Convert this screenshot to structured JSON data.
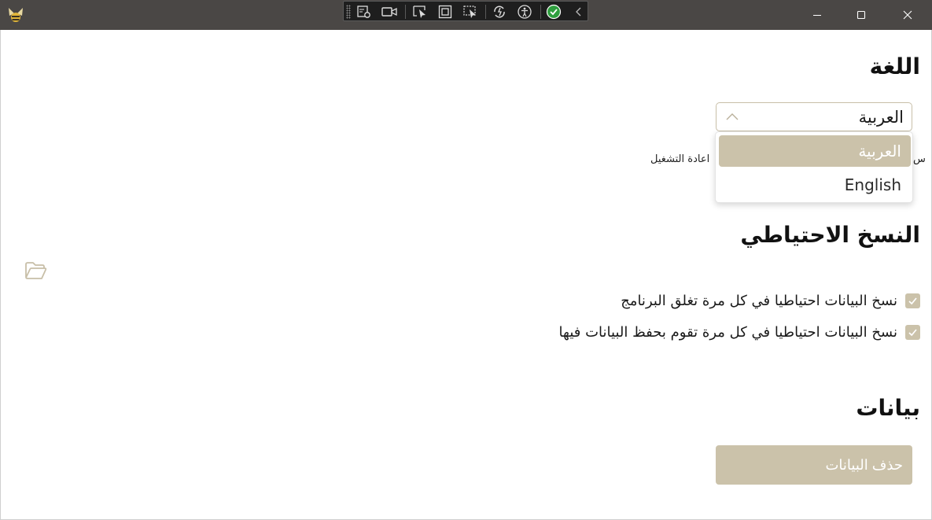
{
  "window": {
    "app_icon": "bee-logo-icon",
    "controls": {
      "minimize": "minimize-icon",
      "maximize": "maximize-icon",
      "close": "close-icon"
    }
  },
  "devtools_toolbar": {
    "items": [
      "live-visual-tree-icon",
      "record-icon",
      "select-element-icon",
      "display-layout-adorners-icon",
      "track-focused-element-icon",
      "hot-reload-icon",
      "accessibility-icon",
      "checks-passed-icon",
      "collapse-chevron-icon"
    ]
  },
  "language": {
    "heading": "اللغة",
    "selected": "العربية",
    "options": [
      "العربية",
      "English"
    ],
    "hint_left": "اعادة التشغيل",
    "hint_right": "س"
  },
  "backup": {
    "heading": "النسخ الاحتياطي",
    "folder_icon": "open-folder-icon",
    "options": [
      {
        "label": "نسخ البيانات احتياطيا في كل مرة تغلق البرنامج",
        "checked": true
      },
      {
        "label": "نسخ البيانات احتياطيا في كل مرة تقوم بحفظ البيانات فيها",
        "checked": true
      }
    ]
  },
  "data": {
    "heading": "بيانات",
    "delete_button": "حذف البيانات"
  },
  "colors": {
    "accent": "#cbc2aa",
    "titlebar": "#4a4745",
    "background": "#ffffff"
  }
}
